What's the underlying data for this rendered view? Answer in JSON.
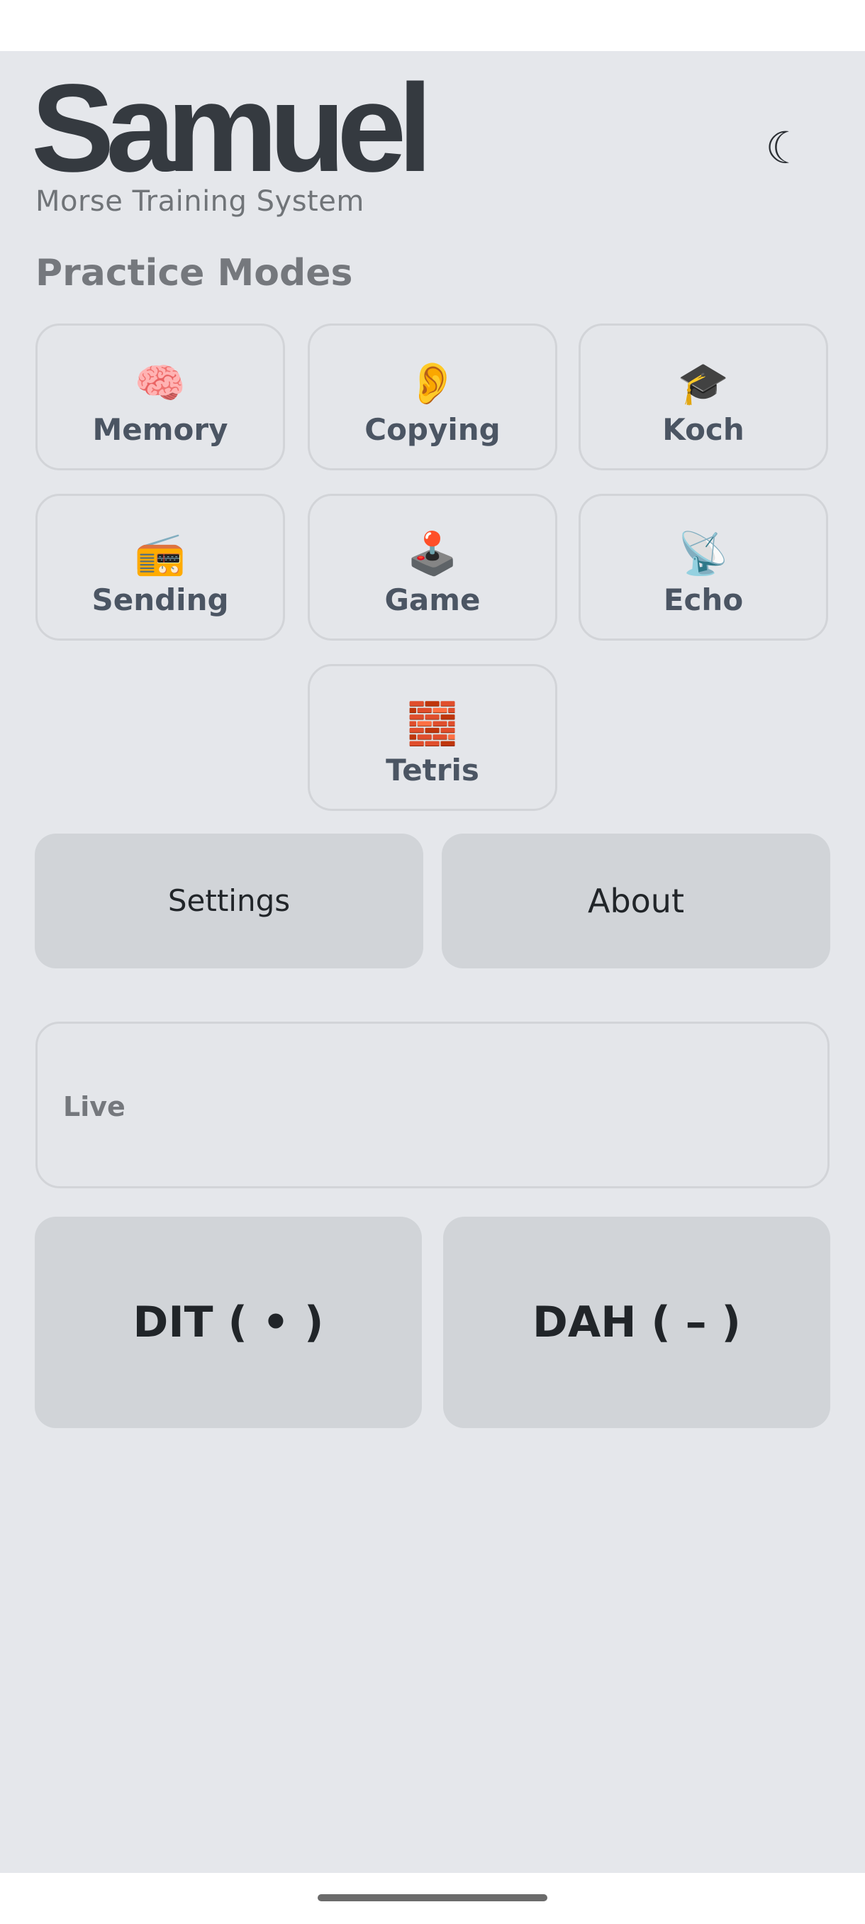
{
  "header": {
    "logo_text": "Samuel",
    "subtitle": "Morse Training System",
    "theme_toggle_icon": "☾"
  },
  "practice": {
    "title": "Practice Modes",
    "modes": [
      {
        "label": "Memory",
        "icon": "🧠",
        "icon_name": "brain-icon"
      },
      {
        "label": "Copying",
        "icon": "👂",
        "icon_name": "ear-icon"
      },
      {
        "label": "Koch",
        "icon": "🎓",
        "icon_name": "graduation-cap-icon"
      },
      {
        "label": "Sending",
        "icon": "📻",
        "icon_name": "radio-icon"
      },
      {
        "label": "Game",
        "icon": "🕹️",
        "icon_name": "joystick-icon"
      },
      {
        "label": "Echo",
        "icon": "📡",
        "icon_name": "satellite-dish-icon"
      },
      {
        "label": "Tetris",
        "icon": "🧱",
        "icon_name": "brick-icon"
      }
    ]
  },
  "actions": {
    "settings_label": "Settings",
    "about_label": "About"
  },
  "live": {
    "label": "Live"
  },
  "keys": {
    "dit_label": "DIT ( • )",
    "dah_label": "DAH ( – )"
  }
}
